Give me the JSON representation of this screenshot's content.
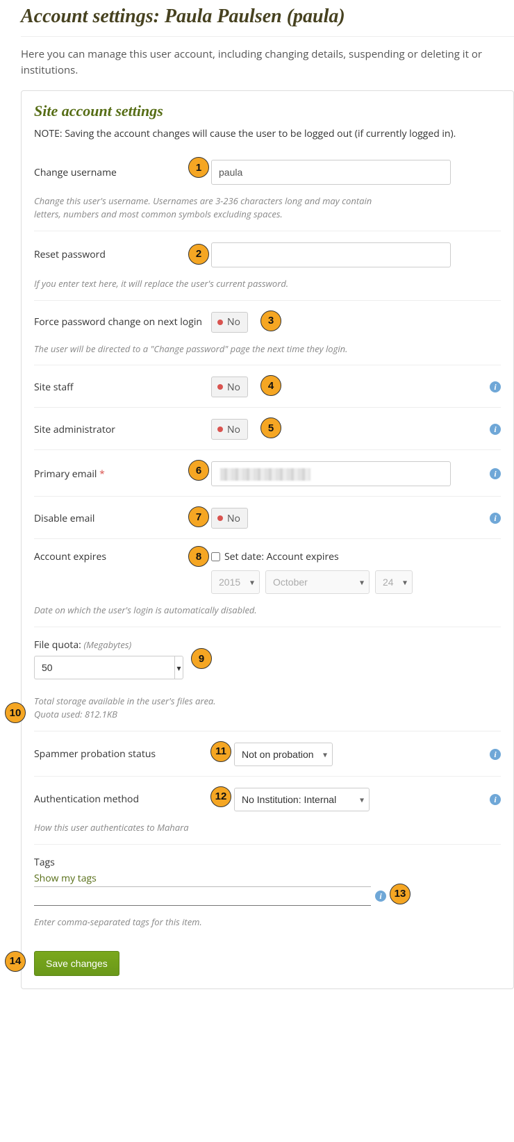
{
  "page": {
    "title": "Account settings: Paula Paulsen (paula)",
    "intro": "Here you can manage this user account, including changing details, suspending or deleting it or institutions."
  },
  "panel": {
    "title": "Site account settings",
    "note": "NOTE: Saving the account changes will cause the user to be logged out (if currently logged in)."
  },
  "fields": {
    "username": {
      "label": "Change username",
      "value": "paula",
      "desc": "Change this user's username. Usernames are 3-236 characters long and may contain letters, numbers and most common symbols excluding spaces."
    },
    "reset_password": {
      "label": "Reset password",
      "value": "",
      "desc": "If you enter text here, it will replace the user's current password."
    },
    "force_pw": {
      "label": "Force password change on next login",
      "value": "No",
      "desc": "The user will be directed to a \"Change password\" page the next time they login."
    },
    "site_staff": {
      "label": "Site staff",
      "value": "No"
    },
    "site_admin": {
      "label": "Site administrator",
      "value": "No"
    },
    "primary_email": {
      "label": "Primary email",
      "required": "*"
    },
    "disable_email": {
      "label": "Disable email",
      "value": "No"
    },
    "account_expires": {
      "label": "Account expires",
      "checkbox_label": "Set date: Account expires",
      "year": "2015",
      "month": "October",
      "day": "24",
      "desc": "Date on which the user's login is automatically disabled."
    },
    "file_quota": {
      "label": "File quota:",
      "unit": "(Megabytes)",
      "value": "50",
      "desc1": "Total storage available in the user's files area.",
      "desc2": "Quota used: 812.1KB"
    },
    "spammer": {
      "label": "Spammer probation status",
      "value": "Not on probation"
    },
    "auth_method": {
      "label": "Authentication method",
      "value": "No Institution: Internal",
      "desc": "How this user authenticates to Mahara"
    },
    "tags": {
      "label": "Tags",
      "link": "Show my tags",
      "desc": "Enter comma-separated tags for this item."
    }
  },
  "buttons": {
    "save": "Save changes"
  },
  "callouts": {
    "n1": "1",
    "n2": "2",
    "n3": "3",
    "n4": "4",
    "n5": "5",
    "n6": "6",
    "n7": "7",
    "n8": "8",
    "n9": "9",
    "n10": "10",
    "n11": "11",
    "n12": "12",
    "n13": "13",
    "n14": "14"
  }
}
